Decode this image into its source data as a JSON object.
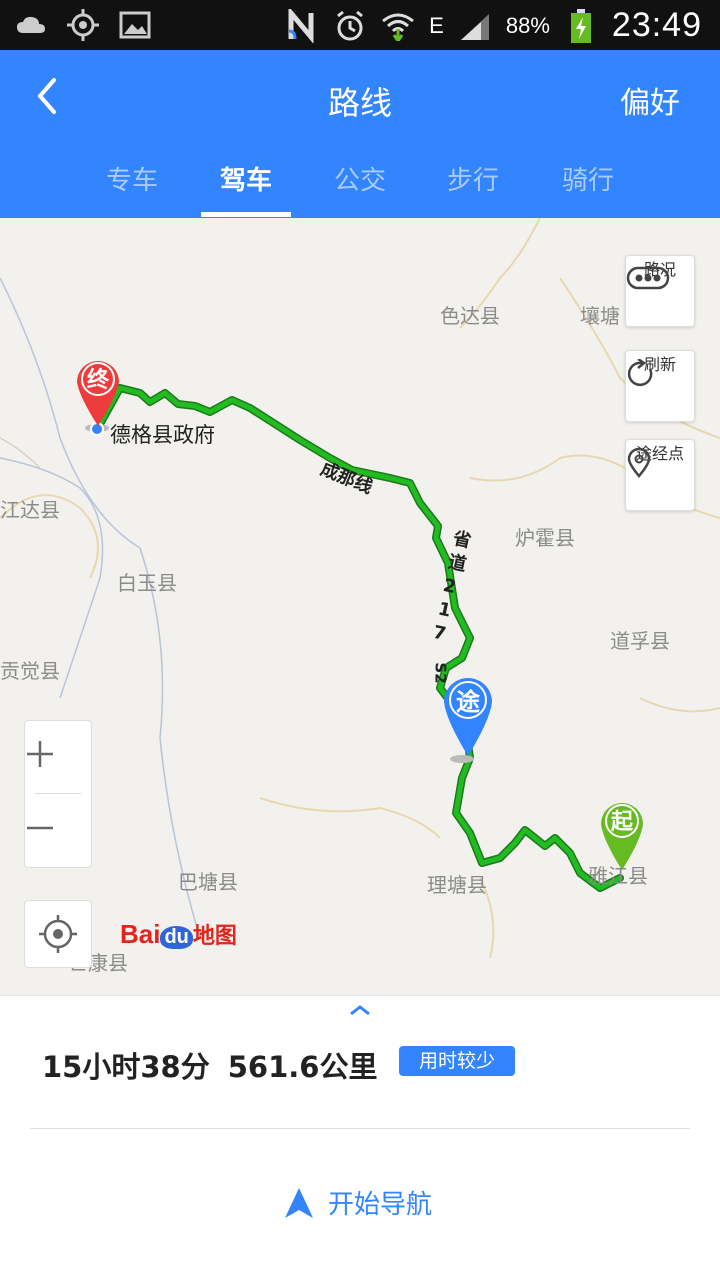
{
  "status_bar": {
    "battery": "88%",
    "time": "23:49",
    "network": "E"
  },
  "header": {
    "title": "路线",
    "preferences": "偏好"
  },
  "tabs": [
    {
      "label": "专车"
    },
    {
      "label": "驾车"
    },
    {
      "label": "公交"
    },
    {
      "label": "步行"
    },
    {
      "label": "骑行"
    }
  ],
  "map": {
    "places": {
      "seda": "色达县",
      "rangtang": "壤塘",
      "luhuo": "炉霍县",
      "daofu": "道孚县",
      "baiyu": "白玉县",
      "jiangda": "江达县",
      "gongjue": "贡觉县",
      "batang": "巴塘县",
      "litang": "理塘县",
      "yajiang": "雅江县",
      "mangkang": "芒康县",
      "dege": "德格县政府"
    },
    "roads": {
      "chengna": "成那线",
      "s217": "省道217",
      "s217_short": "S2"
    },
    "markers": {
      "end": "终",
      "via": "途",
      "start": "起"
    },
    "buttons": {
      "traffic": "路况",
      "refresh": "刷新",
      "waypoint": "途经点"
    },
    "logo": {
      "bai": "Bai",
      "du": "du",
      "ditu": "地图"
    },
    "colors": {
      "route": "#22bb22",
      "route_border": "#1a7a1a",
      "end_marker": "#ee3b3b",
      "via_marker": "#3385ff",
      "start_marker": "#66bb22"
    }
  },
  "summary": {
    "duration": "15小时38分",
    "distance": "561.6公里",
    "badge": "用时较少"
  },
  "nav": {
    "start_label": "开始导航"
  }
}
